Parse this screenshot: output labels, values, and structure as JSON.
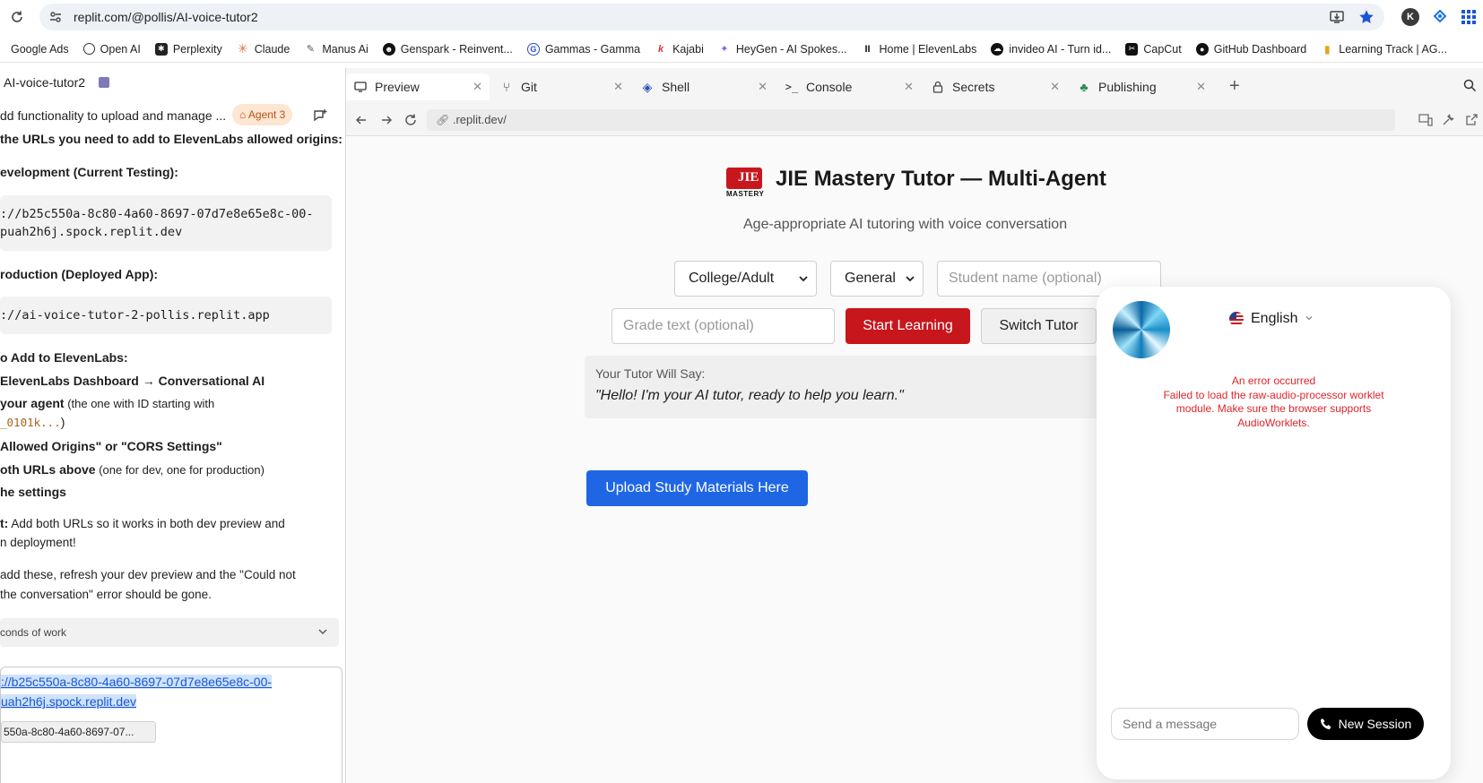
{
  "browser": {
    "url": "replit.com/@pollis/AI-voice-tutor2",
    "bookmarks": [
      {
        "label": "Google Ads",
        "icon": "google-ads-icon"
      },
      {
        "label": "Open AI",
        "icon": "openai-icon"
      },
      {
        "label": "Perplexity",
        "icon": "perplexity-icon"
      },
      {
        "label": "Claude",
        "icon": "claude-icon"
      },
      {
        "label": "Manus Ai",
        "icon": "manus-icon"
      },
      {
        "label": "Genspark - Reinvent...",
        "icon": "genspark-icon"
      },
      {
        "label": "Gammas - Gamma",
        "icon": "gamma-icon"
      },
      {
        "label": "Kajabi",
        "icon": "kajabi-icon"
      },
      {
        "label": "HeyGen - AI Spokes...",
        "icon": "heygen-icon"
      },
      {
        "label": "Home | ElevenLabs",
        "icon": "elevenlabs-icon"
      },
      {
        "label": "invideo AI - Turn id...",
        "icon": "invideo-icon"
      },
      {
        "label": "CapCut",
        "icon": "capcut-icon"
      },
      {
        "label": "GitHub Dashboard",
        "icon": "github-icon"
      },
      {
        "label": "Learning Track | AG...",
        "icon": "chart-icon"
      }
    ],
    "profile_initial": "K"
  },
  "workspace": {
    "project_name": "AI-voice-tutor2",
    "tabs": [
      {
        "label": "Preview",
        "icon": "monitor-icon"
      },
      {
        "label": "Git",
        "icon": "git-icon"
      },
      {
        "label": "Shell",
        "icon": "shell-icon"
      },
      {
        "label": "Console",
        "icon": "console-icon"
      },
      {
        "label": "Secrets",
        "icon": "lock-icon"
      },
      {
        "label": "Publishing",
        "icon": "publishing-icon"
      }
    ],
    "preview_url": ".replit.dev/"
  },
  "chat": {
    "task_title": "dd functionality to upload and manage ...",
    "agent_badge": "Agent 3",
    "lines": {
      "intro": "the URLs you need to add to ElevenLabs allowed origins:",
      "dev_heading": "evelopment (Current Testing):",
      "dev_url_1": "://b25c550a-8c80-4a60-8697-07d7e8e65e8c-00-",
      "dev_url_2": "puah2h6j.spock.replit.dev",
      "prod_heading": "roduction (Deployed App):",
      "prod_url": "://ai-voice-tutor-2-pollis.replit.app",
      "add_heading": "o Add to ElevenLabs:",
      "step1": "ElevenLabs Dashboard → Conversational AI",
      "step2_bold": " your agent",
      "step2_rest": " (the one with ID starting with",
      "step2_code": "_0101k...",
      "step2_close": ")",
      "step3": "Allowed Origins\" or \"CORS Settings\"",
      "step4_bold": "oth URLs above",
      "step4_rest": " (one for dev, one for production)",
      "step5": "he settings",
      "note_bold": "t:",
      "note_rest": " Add both URLs so it works in both dev preview and",
      "note_line2": "n deployment!",
      "final_1": " add these, refresh your dev preview and the \"Could not",
      "final_2": " the conversation\" error should be gone.",
      "work_summary": "conds of work",
      "input_link_1": "://b25c550a-8c80-4a60-8697-07d7e8e65e8c-00-",
      "input_link_2": "uah2h6j.spock.replit.dev",
      "input_chip": "550a-8c80-4a60-8697-07..."
    }
  },
  "app": {
    "logo_text": "JIE",
    "logo_sub": "MASTERY",
    "title": "JIE Mastery Tutor — Multi-Agent",
    "subtitle": "Age-appropriate AI tutoring with voice conversation",
    "level_select": "College/Adult",
    "subject_select": "General",
    "student_placeholder": "Student name (optional)",
    "grade_placeholder": "Grade text (optional)",
    "start_button": "Start Learning",
    "switch_button": "Switch Tutor",
    "say_label": "Your Tutor Will Say:",
    "say_text": "\"Hello! I'm your AI tutor, ready to help you learn.\"",
    "upload_button": "Upload Study Materials Here",
    "colors": {
      "red": "#c8161d",
      "blue": "#1f66e5",
      "error": "#e0242a"
    }
  },
  "widget": {
    "language": "English",
    "error_title": "An error occurred",
    "error_line1": "Failed to load the raw-audio-processor worklet",
    "error_line2": "module. Make sure the browser supports",
    "error_line3": "AudioWorklets.",
    "message_placeholder": "Send a message",
    "new_session": "New Session"
  }
}
